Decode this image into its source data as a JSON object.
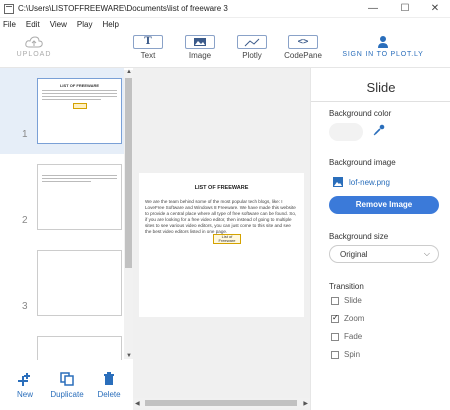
{
  "window": {
    "title": "C:\\Users\\LISTOFFREEWARE\\Documents\\list of freeware 3",
    "minimize": "—",
    "maximize": "☐",
    "close": "✕"
  },
  "menu": [
    "File",
    "Edit",
    "View",
    "Play",
    "Help"
  ],
  "toolbar": {
    "upload": "UPLOAD",
    "text_icon": "T",
    "text": "Text",
    "image": "Image",
    "plotly": "Plotly",
    "codepane_icon": "<>",
    "codepane": "CodePane",
    "signin": "SIGN IN TO PLOT.LY"
  },
  "slides": [
    {
      "number": "1",
      "thumb_title": "LIST OF FREEWARE",
      "selected": true
    },
    {
      "number": "2"
    },
    {
      "number": "3"
    }
  ],
  "sidebar_actions": {
    "new": "New",
    "duplicate": "Duplicate",
    "delete": "Delete"
  },
  "preview": {
    "title": "LIST OF FREEWARE",
    "body": "We are the team behind some of the most popular tech blogs, like: I LoveFree Software and Windows 8 Freeware. We have made this website to provide a central place where all type of free software can be found. So, if you are looking for a free video editor, then instead of going to multiple sites to see various video editors, you can just come to this site and see the best video editors listed in one page.",
    "logo_line1": "List of",
    "logo_line2": "Freeware"
  },
  "panel": {
    "title": "Slide",
    "background_color": "Background color",
    "background_image": "Background image",
    "bg_file": "lof-new.png",
    "remove_image": "Remove Image",
    "background_size": "Background size",
    "bg_size_value": "Original",
    "transition": "Transition",
    "transitions": [
      {
        "label": "Slide",
        "checked": false
      },
      {
        "label": "Zoom",
        "checked": true
      },
      {
        "label": "Fade",
        "checked": false
      },
      {
        "label": "Spin",
        "checked": false
      }
    ]
  },
  "colors": {
    "accent": "#3b7ad9",
    "link": "#2a6ebb",
    "selected_row": "#e6eef8"
  }
}
